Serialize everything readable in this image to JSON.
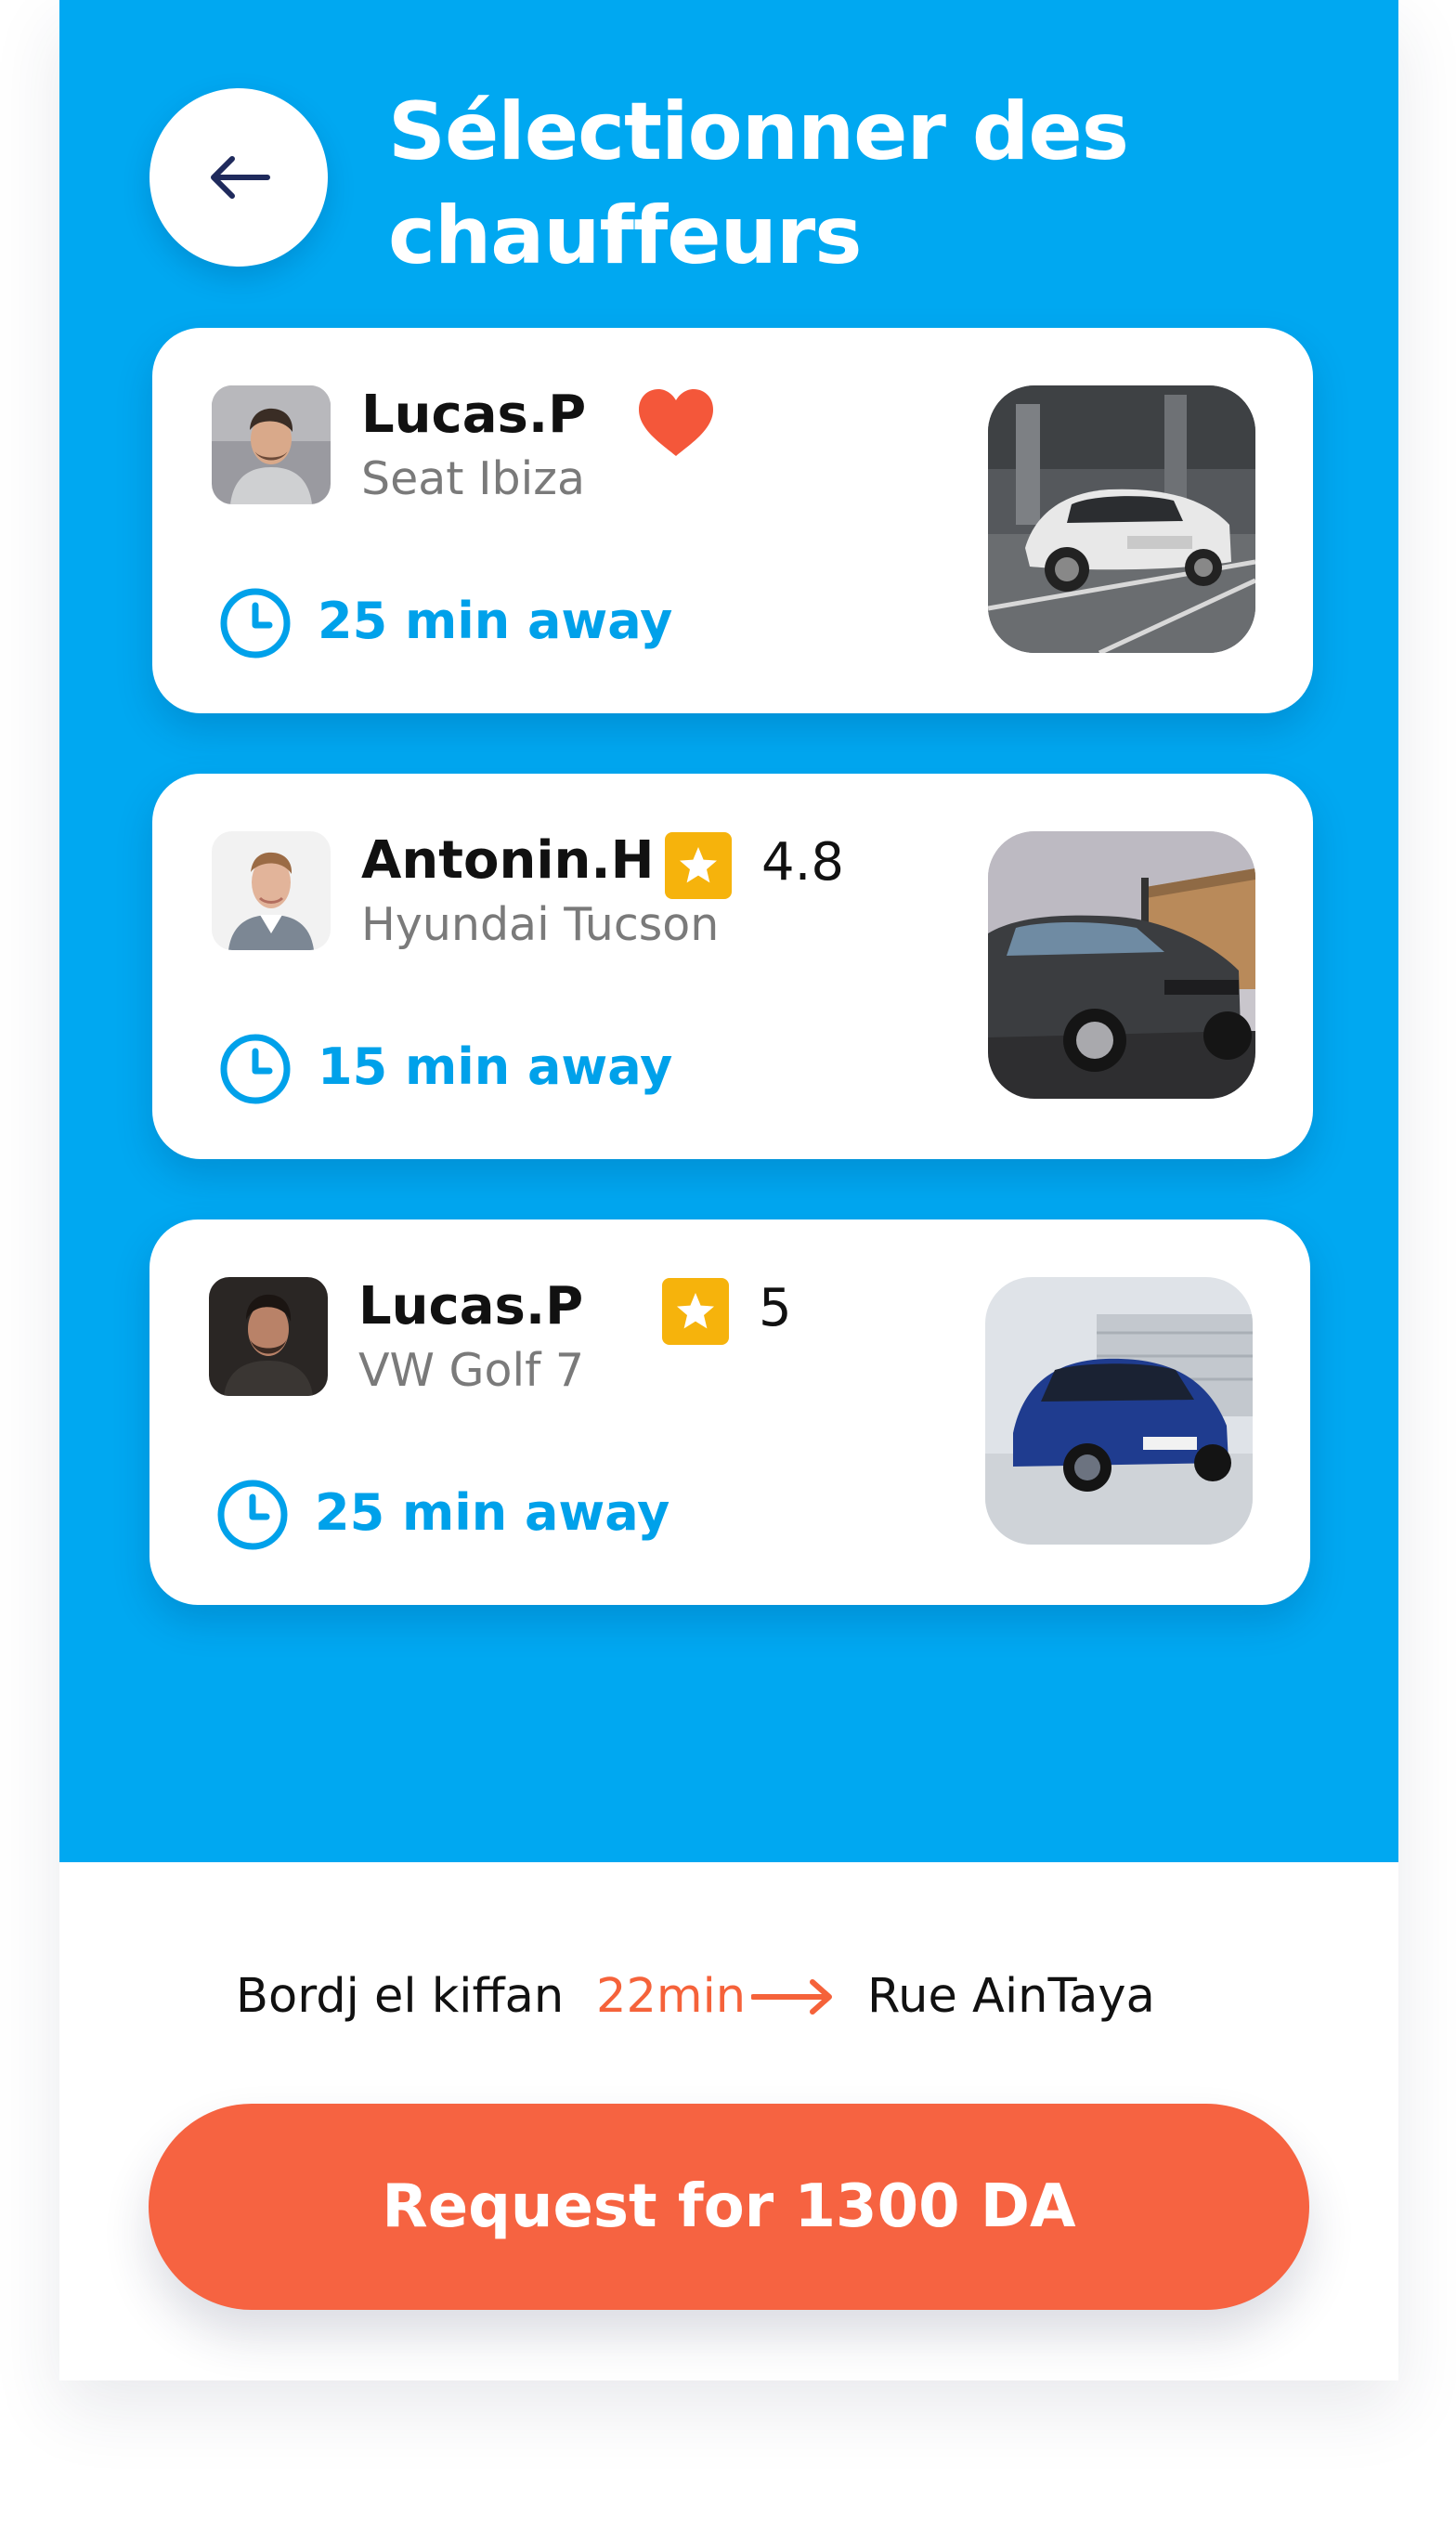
{
  "header": {
    "back_icon": "arrow-left-icon",
    "title": "Sélectionner des chauffeurs"
  },
  "drivers": [
    {
      "name": "Lucas.P",
      "car": "Seat Ibiza",
      "eta": "25 min away",
      "favorite": true,
      "favorite_icon": "heart-icon",
      "rating": null
    },
    {
      "name": "Antonin.H",
      "car": "Hyundai Tucson",
      "eta": "15 min away",
      "favorite": false,
      "rating": "4.8",
      "rating_icon": "star-icon"
    },
    {
      "name": "Lucas.P",
      "car": "VW Golf 7",
      "eta": "25 min away",
      "favorite": false,
      "rating": "5",
      "rating_icon": "star-icon"
    }
  ],
  "route": {
    "from": "Bordj el kiffan",
    "duration": "22min",
    "to": "Rue AinTaya",
    "arrow_icon": "arrow-right-icon"
  },
  "request_button": {
    "label": "Request for 1300 DA"
  },
  "colors": {
    "primary_blue": "#00a8f1",
    "accent_orange": "#f66341",
    "star_yellow": "#f6b30c",
    "heart_red": "#f4573a"
  }
}
